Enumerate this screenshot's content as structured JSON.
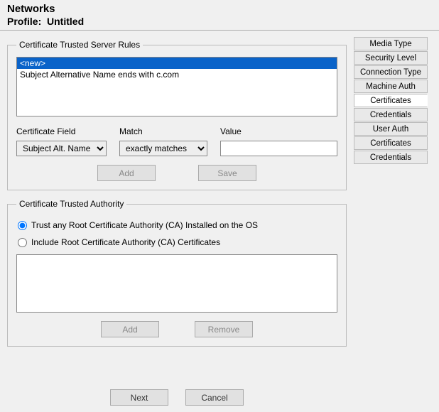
{
  "header": {
    "title": "Networks",
    "profile_label": "Profile:",
    "profile_value": "Untitled"
  },
  "tabs": [
    {
      "label": "Media Type",
      "active": false
    },
    {
      "label": "Security Level",
      "active": false
    },
    {
      "label": "Connection Type",
      "active": false
    },
    {
      "label": "Machine Auth",
      "active": false
    },
    {
      "label": "Certificates",
      "active": true
    },
    {
      "label": "Credentials",
      "active": false
    },
    {
      "label": "User Auth",
      "active": false
    },
    {
      "label": "Certificates",
      "active": false
    },
    {
      "label": "Credentials",
      "active": false
    }
  ],
  "rules": {
    "legend": "Certificate Trusted Server Rules",
    "items": [
      {
        "text": "<new>",
        "selected": true
      },
      {
        "text": "Subject Alternative Name ends with c.com",
        "selected": false
      }
    ],
    "field_label": "Certificate Field",
    "match_label": "Match",
    "value_label": "Value",
    "field_options": [
      "Subject Alt. Name"
    ],
    "field_selected": "Subject Alt. Name",
    "match_options": [
      "exactly matches"
    ],
    "match_selected": "exactly matches",
    "value_text": "",
    "add_label": "Add",
    "save_label": "Save"
  },
  "authority": {
    "legend": "Certificate Trusted Authority",
    "radio_trust_os": "Trust any Root Certificate Authority (CA) Installed on the OS",
    "radio_include": "Include Root Certificate Authority (CA) Certificates",
    "selected": "trust_os",
    "add_label": "Add",
    "remove_label": "Remove"
  },
  "footer": {
    "next_label": "Next",
    "cancel_label": "Cancel"
  }
}
